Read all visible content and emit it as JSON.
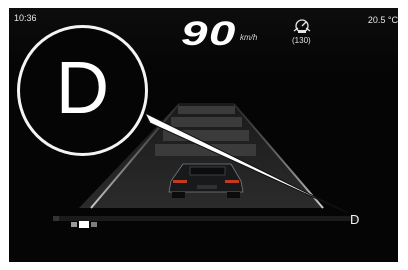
{
  "status_bar": {
    "time": "10:36",
    "outside_temp": "20.5 °C"
  },
  "speedometer": {
    "speed": "90",
    "unit": "km/h"
  },
  "cruise_control": {
    "icon": "adaptive-cruise-icon",
    "set_speed": "(130)"
  },
  "transmission": {
    "gear_indicator": "D",
    "callout_gear": "D"
  },
  "drive_modes": {
    "icon": "drive-mode-indicator-icon"
  },
  "colors": {
    "background": "#050505",
    "text": "#ffffff",
    "frame": "#ffffff"
  }
}
